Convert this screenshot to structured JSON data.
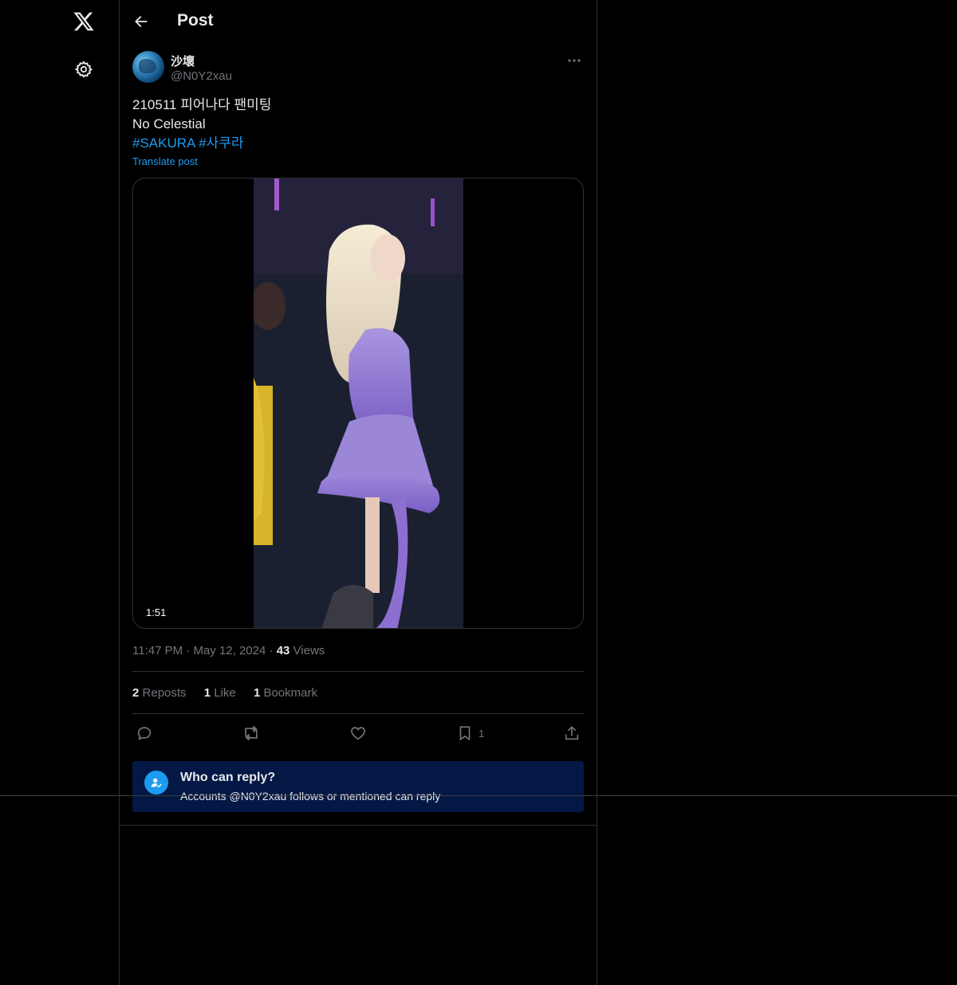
{
  "nav": {
    "logo_icon": "x-logo-icon",
    "settings_icon": "gear-icon"
  },
  "header": {
    "title": "Post"
  },
  "post": {
    "display_name": "沙壞",
    "handle": "@N0Y2xau",
    "text_line1": "210511 피어나다 팬미팅",
    "text_line2": "No Celestial",
    "hashtag1": "#SAKURA",
    "hashtag2": "#사쿠라",
    "translate_label": "Translate post",
    "video_duration": "1:51",
    "time": "11:47 PM",
    "date": "May 12, 2024",
    "views_count": "43",
    "views_label": "Views",
    "separator": "·"
  },
  "stats": {
    "reposts_count": "2",
    "reposts_label": "Reposts",
    "likes_count": "1",
    "likes_label": "Like",
    "bookmarks_count": "1",
    "bookmarks_label": "Bookmark"
  },
  "actions": {
    "bookmark_count": "1"
  },
  "reply_restriction": {
    "title": "Who can reply?",
    "subtitle": "Accounts @N0Y2xau follows or mentioned can reply"
  },
  "colors": {
    "accent": "#1d9bf0",
    "background": "#000000",
    "reply_box": "#031845",
    "muted": "#71767b"
  }
}
